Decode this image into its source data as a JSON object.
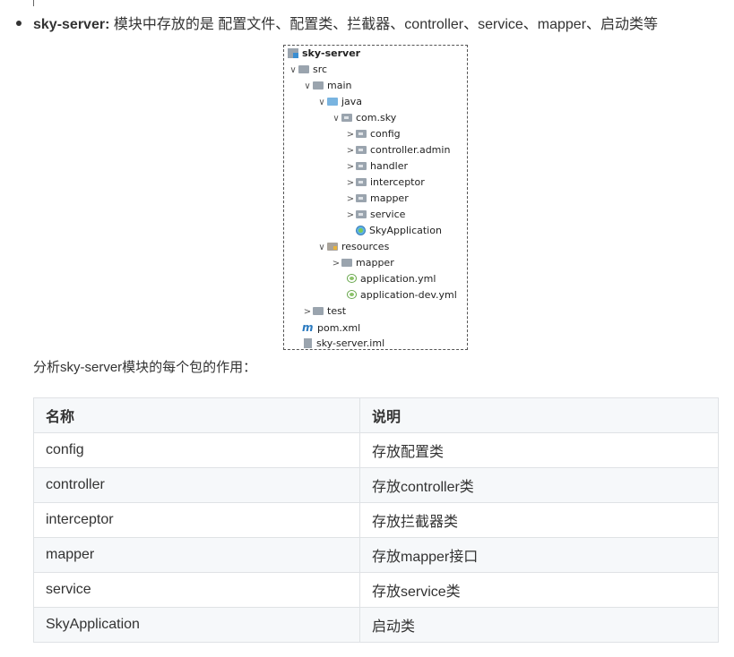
{
  "bullet": {
    "module_name": "sky-server:",
    "description": " 模块中存放的是 配置文件、配置类、拦截器、controller、service、mapper、启动类等"
  },
  "tree": {
    "rows": [
      {
        "label": "sky-server",
        "icon": "module-icon",
        "chevron": "",
        "indent": 0
      },
      {
        "label": "src",
        "icon": "folder-icon",
        "chevron": "∨",
        "indent": 0
      },
      {
        "label": "main",
        "icon": "folder-icon",
        "chevron": "∨",
        "indent": 1
      },
      {
        "label": "java",
        "icon": "source-folder-icon",
        "chevron": "∨",
        "indent": 2
      },
      {
        "label": "com.sky",
        "icon": "package-icon",
        "chevron": "∨",
        "indent": 3
      },
      {
        "label": "config",
        "icon": "package-icon",
        "chevron": ">",
        "indent": 4
      },
      {
        "label": "controller.admin",
        "icon": "package-icon",
        "chevron": ">",
        "indent": 4
      },
      {
        "label": "handler",
        "icon": "package-icon",
        "chevron": ">",
        "indent": 4
      },
      {
        "label": "interceptor",
        "icon": "package-icon",
        "chevron": ">",
        "indent": 4
      },
      {
        "label": "mapper",
        "icon": "package-icon",
        "chevron": ">",
        "indent": 4
      },
      {
        "label": "service",
        "icon": "package-icon",
        "chevron": ">",
        "indent": 4
      },
      {
        "label": "SkyApplication",
        "icon": "spring-class-icon",
        "chevron": "",
        "indent": 4
      },
      {
        "label": "resources",
        "icon": "resources-folder-icon",
        "chevron": "∨",
        "indent": 2
      },
      {
        "label": "mapper",
        "icon": "folder-icon",
        "chevron": ">",
        "indent": 3
      },
      {
        "label": "application.yml",
        "icon": "yml-icon",
        "chevron": "",
        "indent": 3
      },
      {
        "label": "application-dev.yml",
        "icon": "yml-icon",
        "chevron": "",
        "indent": 3
      },
      {
        "label": "test",
        "icon": "folder-icon",
        "chevron": ">",
        "indent": 1
      },
      {
        "label": "pom.xml",
        "icon": "maven-icon",
        "chevron": "",
        "indent": 0
      },
      {
        "label": "sky-server.iml",
        "icon": "iml-file-icon",
        "chevron": "",
        "indent": 0
      }
    ]
  },
  "subtitle": "分析sky-server模块的每个包的作用：",
  "table": {
    "headers": [
      "名称",
      "说明"
    ],
    "rows": [
      [
        "config",
        "存放配置类"
      ],
      [
        "controller",
        "存放controller类"
      ],
      [
        "interceptor",
        "存放拦截器类"
      ],
      [
        "mapper",
        "存放mapper接口"
      ],
      [
        "service",
        "存放service类"
      ],
      [
        "SkyApplication",
        "启动类"
      ]
    ]
  }
}
